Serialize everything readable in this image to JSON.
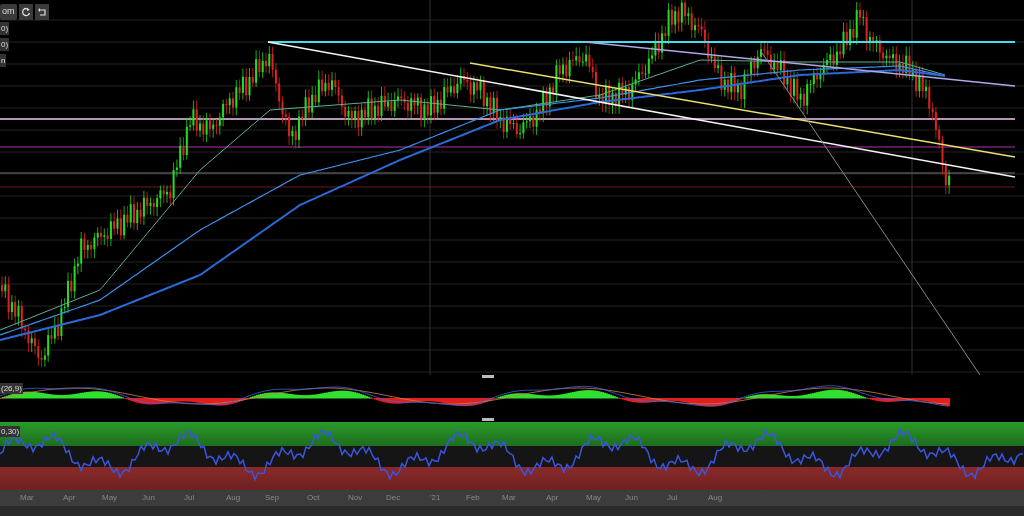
{
  "toolbar": {
    "zoom_button": "om"
  },
  "indicator_labels": [
    "0)",
    "0)",
    "n"
  ],
  "macd_panel": {
    "label": "(26,9)"
  },
  "rsi_panel": {
    "label": "0,30)"
  },
  "time_axis": [
    "Mar",
    "Apr",
    "May",
    "Jun",
    "Jul",
    "Aug",
    "Sep",
    "Oct",
    "Nov",
    "Dec",
    "'21",
    "Feb",
    "Mar",
    "Apr",
    "May",
    "Jun",
    "Jul",
    "Aug"
  ]
}
